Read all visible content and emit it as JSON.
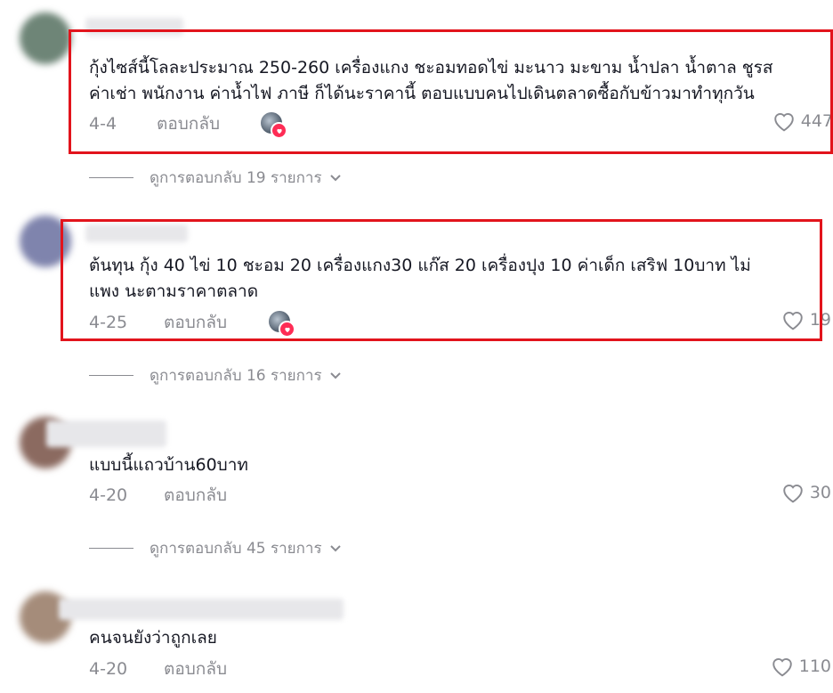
{
  "comments": [
    {
      "text_line1": "กุ้งไซส์นี้โลละประมาณ 250-260 เครื่องแกง ชะอมทอดไข่ มะนาว มะขาม น้ำปลา น้ำตาล ชูรส",
      "text_line2": "ค่าเช่า พนักงาน ค่าน้ำไฟ ภาษี ก็ได้นะราคานี้ ตอบแบบคนไปเดินตลาดซื้อกับข้าวมาทำทุกวัน",
      "date": "4-4",
      "reply_label": "ตอบกลับ",
      "likes": "447",
      "view_replies": "ดูการตอบกลับ 19 รายการ"
    },
    {
      "text_line1": "ต้นทุน กุ้ง 40 ไข่ 10 ชะอม 20 เครื่องแกง30 แก๊ส 20 เครื่องปุง 10 ค่าเด็ก เสริฟ 10บาท ไม่",
      "text_line2": "แพง นะตามราคาตลาด",
      "date": "4-25",
      "reply_label": "ตอบกลับ",
      "likes": "19",
      "view_replies": "ดูการตอบกลับ 16 รายการ"
    },
    {
      "text_line1": "แบบนี้แถวบ้าน60บาท",
      "date": "4-20",
      "reply_label": "ตอบกลับ",
      "likes": "30",
      "view_replies": "ดูการตอบกลับ 45 รายการ"
    },
    {
      "text_line1": "คนจนยังว่าถูกเลย",
      "date": "4-20",
      "reply_label": "ตอบกลับ",
      "likes": "110"
    }
  ],
  "colors": {
    "highlight": "#e2141c",
    "heart_badge": "#fe2c55",
    "muted_text": "#8a8b91"
  },
  "icons": [
    "heart-outline-icon",
    "chevron-down-icon",
    "heart-badge-icon"
  ]
}
